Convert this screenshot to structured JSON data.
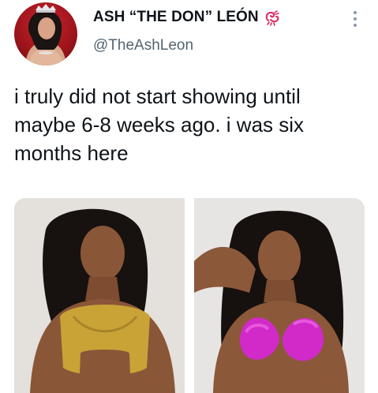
{
  "author": {
    "display_name": "ASH “THE DON” LEÓN",
    "handle": "@TheAshLeon",
    "name_emoji": "scorpion-emoji-icon",
    "avatar": "profile-avatar"
  },
  "tweet": {
    "text": "i truly did not start showing until maybe 6-8 weeks ago. i was six months here"
  },
  "media": [
    {
      "name": "photo-1",
      "top_color": "#c9a336"
    },
    {
      "name": "photo-2",
      "top_color": "#d12ac9"
    }
  ],
  "colors": {
    "text": "#0f1419",
    "secondary_text": "#536471",
    "emoji": "#e0245e"
  }
}
